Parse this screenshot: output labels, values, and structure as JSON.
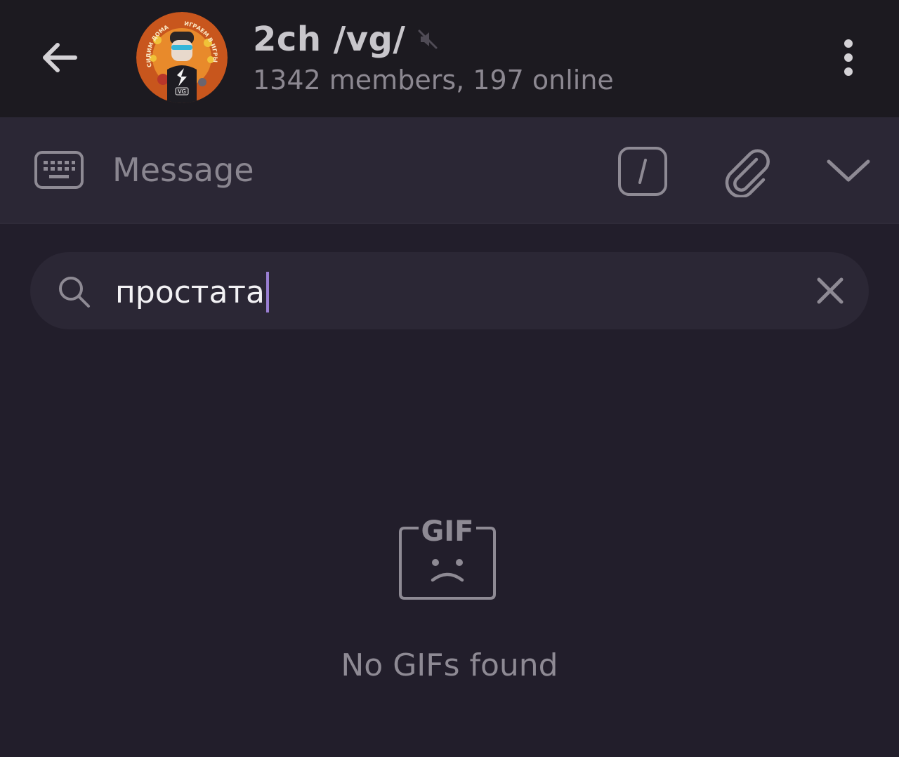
{
  "header": {
    "back_icon": "arrow-left-icon",
    "title": "2ch /vg/",
    "muted_icon": "speaker-muted-icon",
    "subtitle": "1342 members, 197 online",
    "menu_icon": "more-vertical-icon",
    "avatar_text_top_left": "СИДИМ ДОМА",
    "avatar_text_top_right": "ИГРАЕМ В ИГРЫ",
    "avatar_badge": "VG"
  },
  "input_bar": {
    "keyboard_icon": "keyboard-icon",
    "placeholder": "Message",
    "commands_icon": "slash-command-icon",
    "attach_icon": "paperclip-icon",
    "collapse_icon": "chevron-down-icon"
  },
  "gif_search": {
    "search_icon": "search-icon",
    "query": "простата",
    "clear_icon": "close-icon"
  },
  "empty_state": {
    "icon": "sad-gif-icon",
    "icon_label": "GIF",
    "message": "No GIFs found"
  },
  "colors": {
    "background": "#221e2b",
    "header_background": "#1c1a20",
    "bar_background": "#2b2735",
    "caret": "#9a7fd3"
  }
}
